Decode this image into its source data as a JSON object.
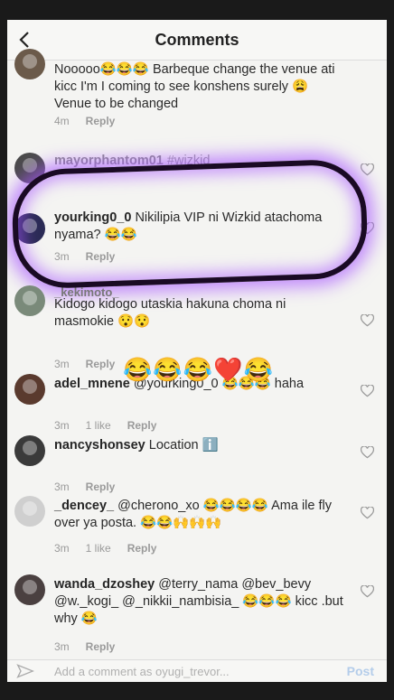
{
  "header": {
    "title": "Comments"
  },
  "comments": [
    {
      "user": "",
      "text": "Nooooo😂😂😂 Barbeque change the venue ati kicc I'm I coming to see konshens surely 😩 Venue to be changed",
      "time": "4m",
      "likes": "",
      "reply": "Reply"
    },
    {
      "user": "mayorphantom01",
      "text": "#wizkid",
      "time": "",
      "likes": "",
      "reply": ""
    },
    {
      "user": "yourking0_0",
      "text": "Nikilipia VIP ni Wizkid atachoma nyama? 😂😂",
      "time": "3m",
      "likes": "",
      "reply": "Reply"
    },
    {
      "user": "_kekimoto_",
      "text": "Kidogo kidogo utaskia hakuna choma ni masmokie 😯😯",
      "time": "3m",
      "likes": "",
      "reply": "Reply"
    },
    {
      "user": "adel_mnene",
      "text": "@yourking0_0 😂😂😂 haha",
      "time": "3m",
      "likes": "1 like",
      "reply": "Reply"
    },
    {
      "user": "nancyshonsey",
      "text": "Location ℹ️",
      "time": "3m",
      "likes": "",
      "reply": "Reply"
    },
    {
      "user": "_dencey_",
      "text": "@cherono_xo 😂😂😂😂 Ama ile fly over ya posta. 😂😂🙌🙌🙌",
      "time": "3m",
      "likes": "1 like",
      "reply": "Reply"
    },
    {
      "user": "wanda_dzoshey",
      "text": "@terry_nama @bev_bevy @w._kogi_ @_nikkii_nambisia_ 😂😂😂 kicc .but why 😂",
      "time": "3m",
      "likes": "",
      "reply": "Reply"
    }
  ],
  "overlay_emoji": "😂😂😂❤️😂",
  "footer": {
    "placeholder": "Add a comment as oyugi_trevor...",
    "post": "Post"
  }
}
